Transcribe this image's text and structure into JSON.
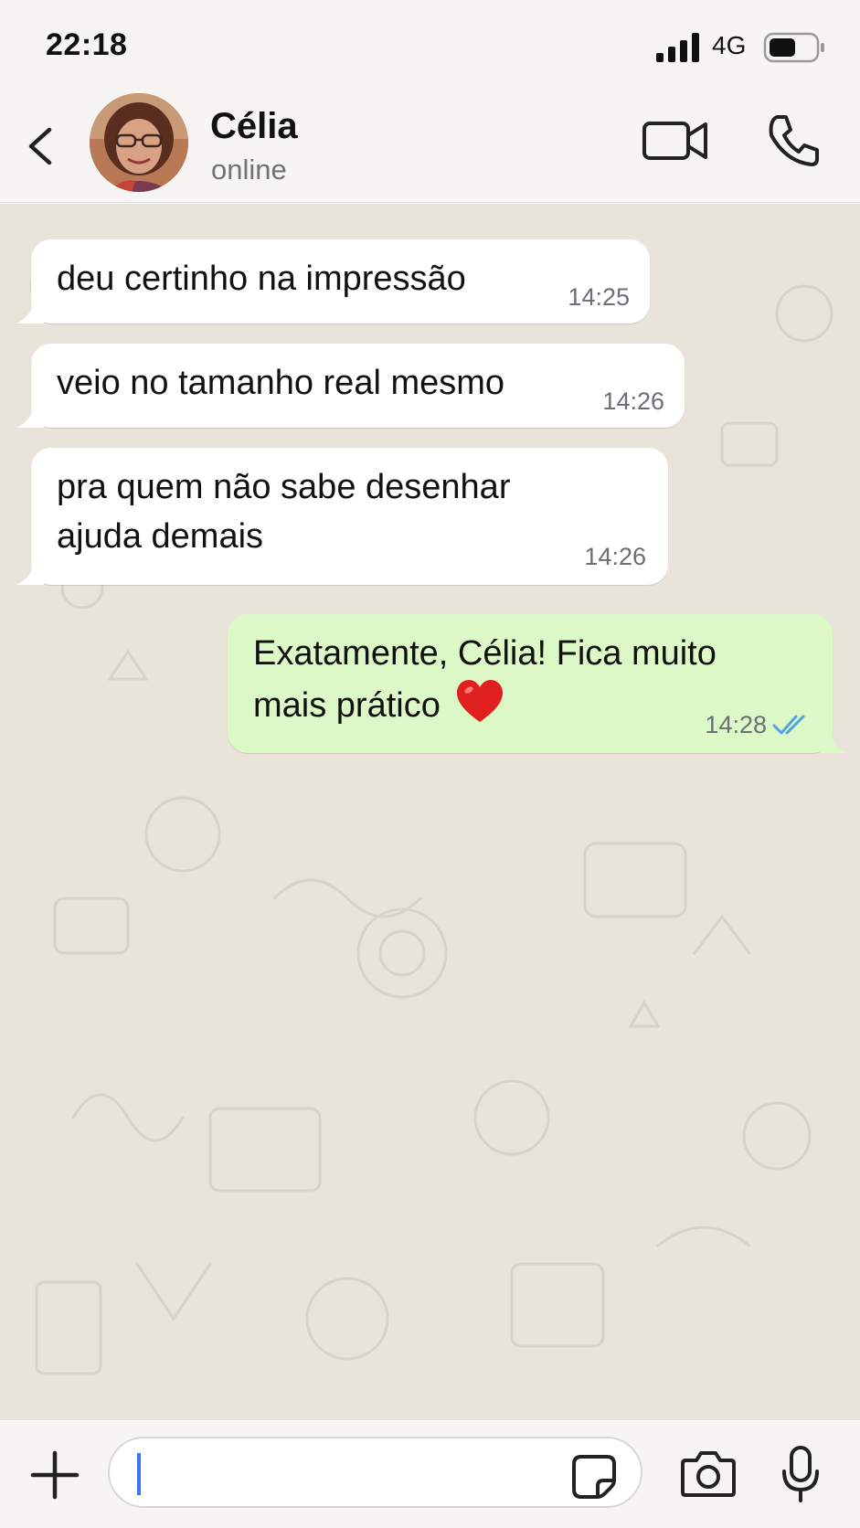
{
  "status_bar": {
    "time": "22:18",
    "network": "4G"
  },
  "header": {
    "contact_name": "Célia",
    "contact_status": "online"
  },
  "messages": [
    {
      "direction": "incoming",
      "text": "deu certinho na impressão",
      "time": "14:25"
    },
    {
      "direction": "incoming",
      "text": "veio no tamanho real mesmo",
      "time": "14:26"
    },
    {
      "direction": "incoming",
      "lines": [
        "pra quem não sabe desenhar",
        "ajuda demais"
      ],
      "time": "14:26"
    },
    {
      "direction": "outgoing",
      "lines": [
        "Exatamente, Célia! Fica muito",
        "mais prático"
      ],
      "emoji": "heart",
      "time": "14:28",
      "status": "read"
    }
  ],
  "composer": {
    "value": "",
    "placeholder": ""
  },
  "icons": {
    "back": "chevron-left-icon",
    "video": "video-camera-icon",
    "call": "phone-icon",
    "plus": "plus-icon",
    "sticker": "sticker-icon",
    "camera": "camera-icon",
    "mic": "microphone-icon",
    "read_receipt": "double-check-icon"
  },
  "colors": {
    "incoming_bubble": "#ffffff",
    "outgoing_bubble": "#dcf8c6",
    "chat_background": "#e9e4da",
    "read_check": "#4fa3e0",
    "cursor": "#3a76f0"
  }
}
